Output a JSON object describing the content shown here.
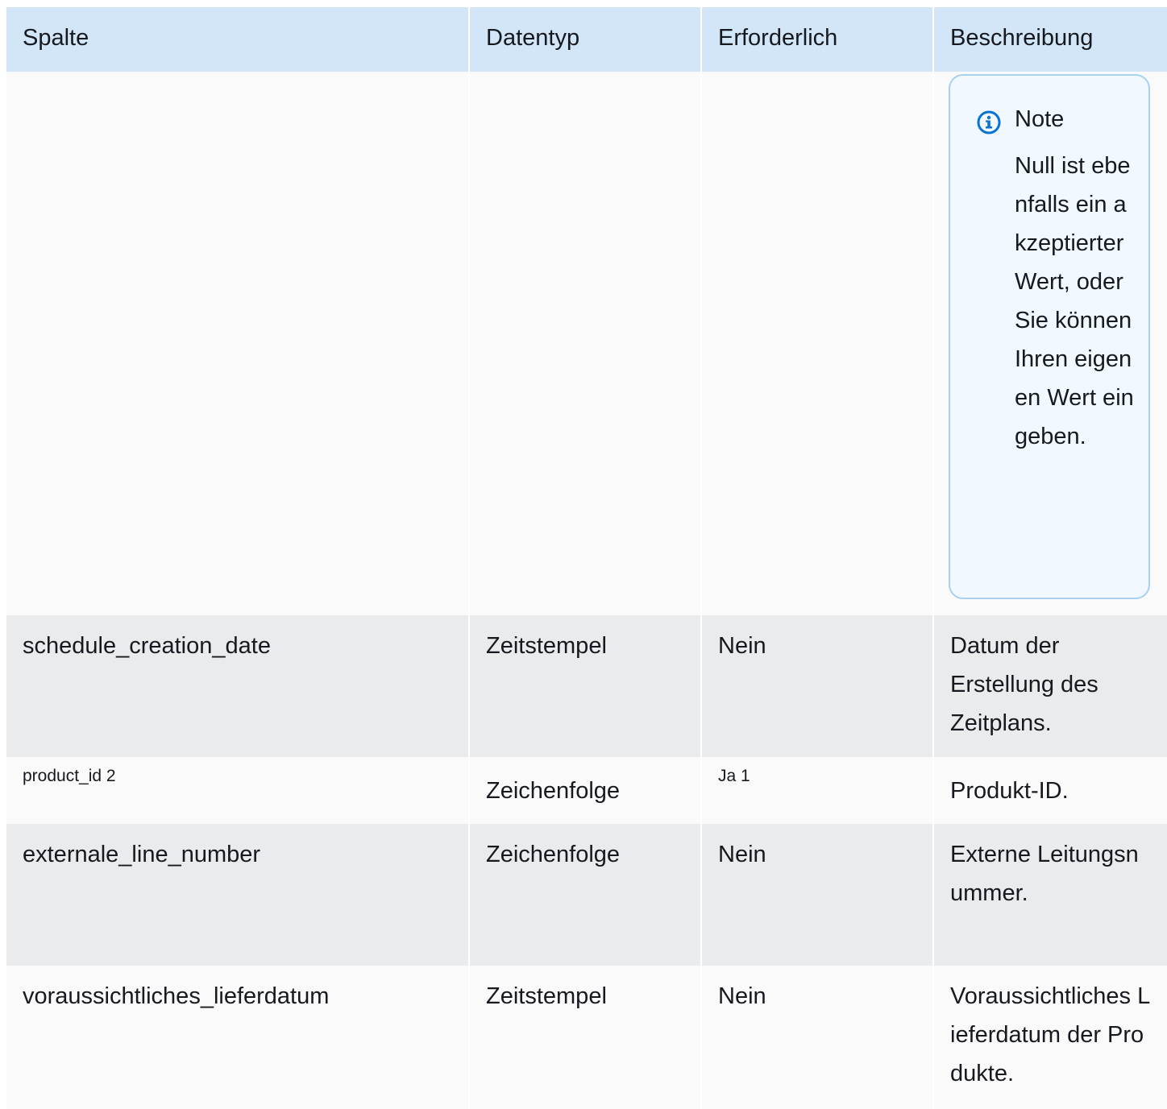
{
  "table": {
    "headers": [
      "Spalte",
      "Datentyp",
      "Erforderlich",
      "Beschreibung"
    ],
    "note": {
      "icon": "info-icon",
      "title": "Note",
      "text": "Null ist ebenfalls ein akzeptierter Wert, oder Sie können Ihren eigenen Wert eingeben."
    },
    "rows": [
      {
        "spalte": "schedule_creation_date",
        "datentyp": "Zeitstempel",
        "erforderlich": "Nein",
        "beschreibung": "Datum der Erstellung des Zeitplans."
      },
      {
        "spalte": "product_id 2",
        "datentyp": "Zeichenfolge",
        "erforderlich": "Ja 1",
        "beschreibung": "Produkt-ID."
      },
      {
        "spalte": "externale_line_number",
        "datentyp": "Zeichenfolge",
        "erforderlich": "Nein",
        "beschreibung": "Externe Leitungsnummer."
      },
      {
        "spalte": "voraussichtliches_lieferdatum",
        "datentyp": "Zeitstempel",
        "erforderlich": "Nein",
        "beschreibung": "Voraussichtliches Lieferdatum der Produkte."
      }
    ]
  },
  "colors": {
    "header_bg": "#d3e6f8",
    "row_light": "#fafafa",
    "row_dark": "#e9ebed",
    "note_border": "#a8d1ef",
    "note_bg": "#f1f8ff",
    "info_icon": "#0972d3"
  }
}
